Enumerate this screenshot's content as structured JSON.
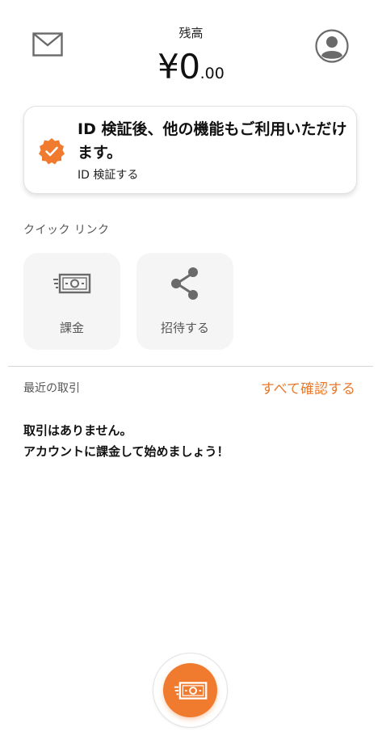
{
  "header": {
    "mail_icon": "mail-icon",
    "profile_icon": "profile-icon",
    "balance_label": "残高",
    "balance_main": "¥0",
    "balance_decimal": ".00"
  },
  "verify_card": {
    "icon": "verified-badge-icon",
    "title": "ID 検証後、他の機能もご利用いただけます。",
    "action": "ID 検証する"
  },
  "quick_links": {
    "title": "クイック リンク",
    "items": [
      {
        "label": "課金",
        "icon": "money-icon"
      },
      {
        "label": "招待する",
        "icon": "share-icon"
      }
    ]
  },
  "recent": {
    "title": "最近の取引",
    "see_all": "すべて確認する",
    "empty_line1": "取引はありません。",
    "empty_line2": "アカウントに課金して始めましょう！"
  },
  "fab": {
    "icon": "money-icon"
  },
  "colors": {
    "accent": "#f07a2e",
    "link": "#e77a2e",
    "tile_bg": "#f5f5f5",
    "icon_gray": "#666666"
  }
}
